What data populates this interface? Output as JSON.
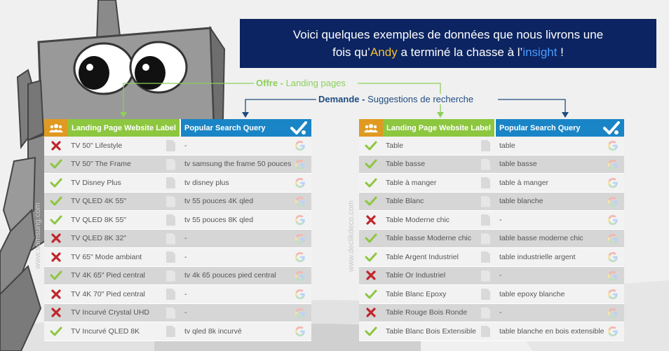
{
  "banner": {
    "line1": "Voici quelques exemples de données que nous livrons une",
    "line2_pre": "fois qu’",
    "line2_andy": "Andy",
    "line2_mid": " a terminé la chasse à l’",
    "line2_insight": "insight",
    "line2_post": " !"
  },
  "legend": {
    "offre_key": "Offre -",
    "offre_text": " Landing pages",
    "demande_key": "Demande -",
    "demande_text": " Suggestions de recherche"
  },
  "watermarks": {
    "left": "www.samsung.com",
    "right": "www.declikdeco.com"
  },
  "tables": [
    {
      "header_label": "Landing Page Website Label",
      "header_query": "Popular Search Query",
      "rows": [
        {
          "status": "cross",
          "label": "TV 50\" Lifestyle",
          "query": "-"
        },
        {
          "status": "check",
          "label": "TV 50\" The Frame",
          "query": "tv samsung the frame 50 pouces"
        },
        {
          "status": "check",
          "label": "TV Disney Plus",
          "query": "tv disney plus"
        },
        {
          "status": "check",
          "label": "TV QLED 4K 55\"",
          "query": "tv 55 pouces 4K qled"
        },
        {
          "status": "check",
          "label": "TV QLED 8K 55\"",
          "query": "tv 55 pouces 8K qled"
        },
        {
          "status": "cross",
          "label": "TV QLED 8K 32\"",
          "query": "-"
        },
        {
          "status": "cross",
          "label": "TV 65\" Mode ambiant",
          "query": "-"
        },
        {
          "status": "check",
          "label": "TV 4K 65\" Pied central",
          "query": "tv 4k 65 pouces pied central"
        },
        {
          "status": "cross",
          "label": "TV 4K 70\" Pied central",
          "query": "-"
        },
        {
          "status": "cross",
          "label": "TV Incurvé Crystal UHD",
          "query": "-"
        },
        {
          "status": "check",
          "label": "TV Incurvé QLED 8K",
          "query": "tv qled 8k incurvé"
        }
      ]
    },
    {
      "header_label": "Landing Page Website Label",
      "header_query": "Popular Search Query",
      "rows": [
        {
          "status": "check",
          "label": "Table",
          "query": "table"
        },
        {
          "status": "check",
          "label": "Table basse",
          "query": "table basse"
        },
        {
          "status": "check",
          "label": "Table à manger",
          "query": "table à manger"
        },
        {
          "status": "check",
          "label": "Table Blanc",
          "query": "table blanche"
        },
        {
          "status": "cross",
          "label": "Table Moderne chic",
          "query": "-"
        },
        {
          "status": "check",
          "label": "Table basse Moderne chic",
          "query": "table basse moderne chic"
        },
        {
          "status": "check",
          "label": "Table Argent Industriel",
          "query": "table industrielle argent"
        },
        {
          "status": "cross",
          "label": "Table Or Industriel",
          "query": "-"
        },
        {
          "status": "check",
          "label": "Table Blanc Epoxy",
          "query": "table epoxy blanche"
        },
        {
          "status": "cross",
          "label": "Table Rouge Bois Ronde",
          "query": "-"
        },
        {
          "status": "check",
          "label": "Table Blanc Bois Extensible",
          "query": "table blanche en bois extensible"
        }
      ]
    }
  ],
  "colors": {
    "banner_bg": "#0c2461",
    "andy": "#f7c02c",
    "insight": "#4a9bff",
    "offre": "#8dcf5b",
    "demande": "#1f4c80",
    "check": "#8dc63f",
    "cross": "#c0262c",
    "header_icon_bg": "#e09a22",
    "header_label_bg": "#8dc63f",
    "header_query_bg": "#1a85c6"
  }
}
